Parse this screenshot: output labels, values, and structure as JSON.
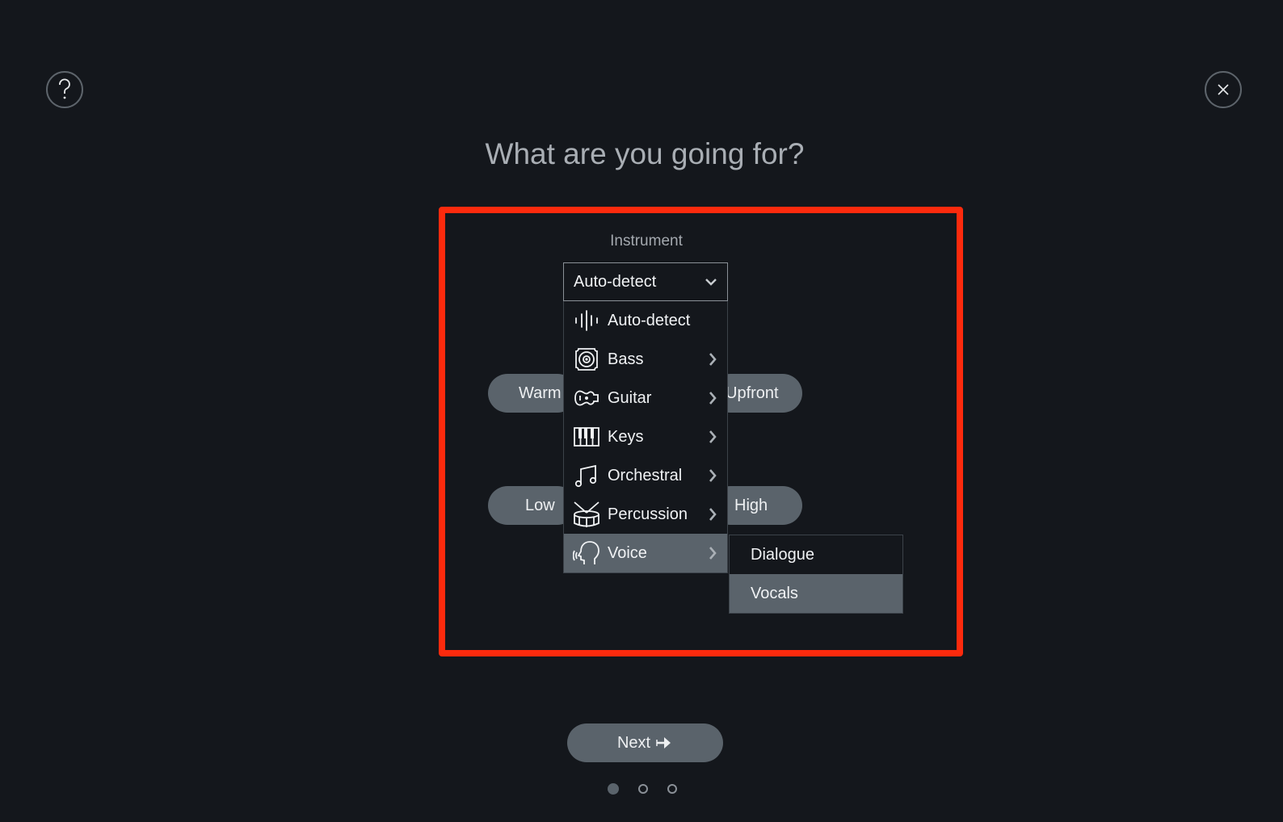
{
  "page": {
    "title": "What are you going for?",
    "help_icon": "question-mark-icon",
    "close_icon": "close-x-icon"
  },
  "instrument": {
    "label": "Instrument",
    "selected": "Auto-detect",
    "menu": [
      {
        "label": "Auto-detect",
        "icon": "waveform-icon",
        "has_submenu": false
      },
      {
        "label": "Bass",
        "icon": "speaker-icon",
        "has_submenu": true
      },
      {
        "label": "Guitar",
        "icon": "guitar-icon",
        "has_submenu": true
      },
      {
        "label": "Keys",
        "icon": "piano-keys-icon",
        "has_submenu": true
      },
      {
        "label": "Orchestral",
        "icon": "music-note-icon",
        "has_submenu": true
      },
      {
        "label": "Percussion",
        "icon": "drum-icon",
        "has_submenu": true
      },
      {
        "label": "Voice",
        "icon": "voice-head-icon",
        "has_submenu": true,
        "active": true
      }
    ],
    "submenu": [
      {
        "label": "Dialogue"
      },
      {
        "label": "Vocals",
        "active": true
      }
    ]
  },
  "pills": {
    "warm": "Warm",
    "upfront": "Upfront",
    "low": "Low",
    "high": "High"
  },
  "footer": {
    "next_label": "Next",
    "pagination": {
      "current": 1,
      "total": 3
    }
  },
  "colors": {
    "background": "#14171c",
    "accent_fill": "#5a636b",
    "highlight": "#fc2a0d"
  }
}
